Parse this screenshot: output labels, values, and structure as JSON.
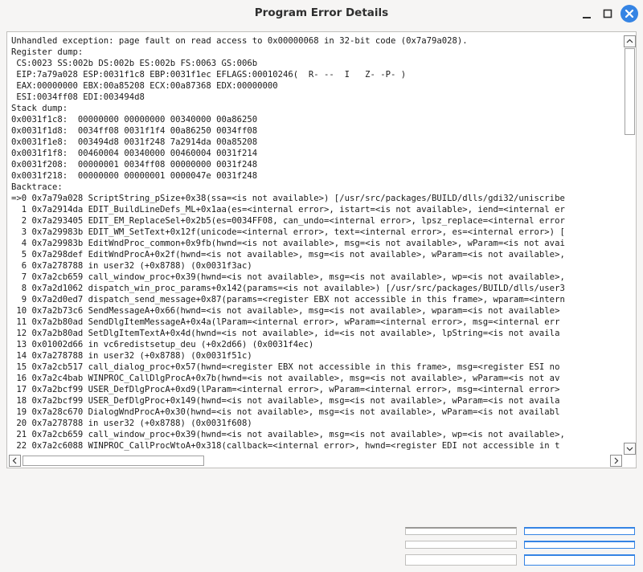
{
  "window": {
    "title": "Program Error Details"
  },
  "icons": {
    "minimize": "minimize-icon",
    "maximize": "maximize-icon",
    "close": "close-icon",
    "scroll_up": "arrow-up-icon",
    "scroll_down": "arrow-down-icon",
    "scroll_left": "arrow-left-icon",
    "scroll_right": "arrow-right-icon"
  },
  "colors": {
    "accent": "#3584e4",
    "background": "#f6f5f4",
    "text": "#1a1a1a"
  },
  "error_details": {
    "lines": [
      "Unhandled exception: page fault on read access to 0x00000068 in 32-bit code (0x7a79a028).",
      "Register dump:",
      " CS:0023 SS:002b DS:002b ES:002b FS:0063 GS:006b",
      " EIP:7a79a028 ESP:0031f1c8 EBP:0031f1ec EFLAGS:00010246(  R- --  I   Z- -P- )",
      " EAX:00000000 EBX:00a85208 ECX:00a87368 EDX:00000000",
      " ESI:0034ff08 EDI:003494d8",
      "Stack dump:",
      "0x0031f1c8:  00000000 00000000 00340000 00a86250",
      "0x0031f1d8:  0034ff08 0031f1f4 00a86250 0034ff08",
      "0x0031f1e8:  003494d8 0031f248 7a2914da 00a85208",
      "0x0031f1f8:  00460004 00340000 00460004 0031f214",
      "0x0031f208:  00000001 0034ff08 00000000 0031f248",
      "0x0031f218:  00000000 00000001 0000047e 0031f248",
      "Backtrace:",
      "=>0 0x7a79a028 ScriptString_pSize+0x38(ssa=<is not available>) [/usr/src/packages/BUILD/dlls/gdi32/uniscribe",
      "  1 0x7a2914da EDIT_BuildLineDefs_ML+0x1aa(es=<internal error>, istart=<is not available>, iend=<internal er",
      "  2 0x7a293405 EDIT_EM_ReplaceSel+0x2b5(es=0034FF08, can_undo=<internal error>, lpsz_replace=<internal error",
      "  3 0x7a29983b EDIT_WM_SetText+0x12f(unicode=<internal error>, text=<internal error>, es=<internal error>) [",
      "  4 0x7a29983b EditWndProc_common+0x9fb(hwnd=<is not available>, msg=<is not available>, wParam=<is not avai",
      "  5 0x7a298def EditWndProcA+0x2f(hwnd=<is not available>, msg=<is not available>, wParam=<is not available>,",
      "  6 0x7a278788 in user32 (+0x8788) (0x0031f3ac)",
      "  7 0x7a2cb659 call_window_proc+0x39(hwnd=<is not available>, msg=<is not available>, wp=<is not available>,",
      "  8 0x7a2d1062 dispatch_win_proc_params+0x142(params=<is not available>) [/usr/src/packages/BUILD/dlls/user3",
      "  9 0x7a2d0ed7 dispatch_send_message+0x87(params=<register EBX not accessible in this frame>, wparam=<intern",
      " 10 0x7a2b73c6 SendMessageA+0x66(hwnd=<is not available>, msg=<is not available>, wparam=<is not available>",
      " 11 0x7a2b80ad SendDlgItemMessageA+0x4a(lParam=<internal error>, wParam=<internal error>, msg=<internal err",
      " 12 0x7a2b80ad SetDlgItemTextA+0x4d(hwnd=<is not available>, id=<is not available>, lpString=<is not availa",
      " 13 0x01002d66 in vc6redistsetup_deu (+0x2d66) (0x0031f4ec)",
      " 14 0x7a278788 in user32 (+0x8788) (0x0031f51c)",
      " 15 0x7a2cb517 call_dialog_proc+0x57(hwnd=<register EBX not accessible in this frame>, msg=<register ESI no",
      " 16 0x7a2c4bab WINPROC_CallDlgProcA+0x7b(hwnd=<is not available>, msg=<is not available>, wParam=<is not av",
      " 17 0x7a2bcf99 USER_DefDlgProcA+0xd9(lParam=<internal error>, wParam=<internal error>, msg=<internal error>",
      " 18 0x7a2bcf99 USER_DefDlgProc+0x149(hwnd=<is not available>, msg=<is not available>, wParam=<is not availa",
      " 19 0x7a28c670 DialogWndProcA+0x30(hwnd=<is not available>, msg=<is not available>, wParam=<is not availabl",
      " 20 0x7a278788 in user32 (+0x8788) (0x0031f608)",
      " 21 0x7a2cb659 call_window_proc+0x39(hwnd=<is not available>, msg=<is not available>, wp=<is not available>,",
      " 22 0x7a2c6088 WINPROC_CallProcWtoA+0x318(callback=<internal error>, hwnd=<register EDI not accessible in t"
    ]
  },
  "buttons": [
    {
      "label": ""
    },
    {
      "label": ""
    },
    {
      "label": ""
    },
    {
      "label": ""
    },
    {
      "label": ""
    },
    {
      "label": ""
    }
  ]
}
